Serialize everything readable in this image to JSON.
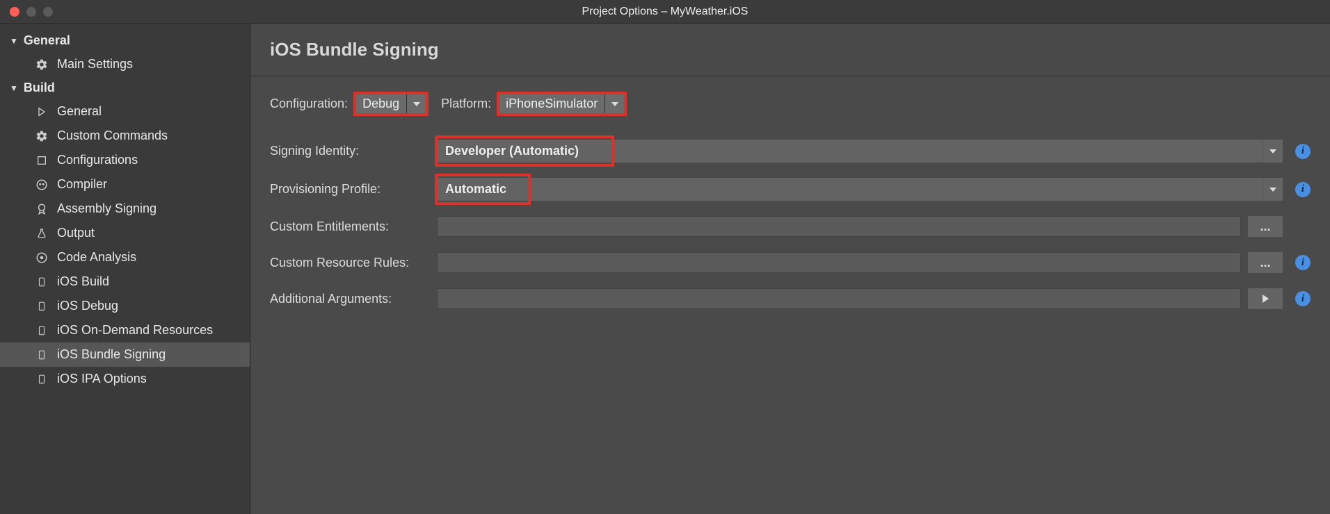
{
  "window": {
    "title": "Project Options – MyWeather.iOS"
  },
  "colors": {
    "close": "#ff5f57",
    "min": "#5b5b5b",
    "max": "#5b5b5b"
  },
  "sidebar": {
    "general": {
      "label": "General",
      "items": [
        {
          "label": "Main Settings"
        }
      ]
    },
    "build": {
      "label": "Build",
      "items": [
        {
          "label": "General"
        },
        {
          "label": "Custom Commands"
        },
        {
          "label": "Configurations"
        },
        {
          "label": "Compiler"
        },
        {
          "label": "Assembly Signing"
        },
        {
          "label": "Output"
        },
        {
          "label": "Code Analysis"
        },
        {
          "label": "iOS Build"
        },
        {
          "label": "iOS Debug"
        },
        {
          "label": "iOS On-Demand Resources"
        },
        {
          "label": "iOS Bundle Signing"
        },
        {
          "label": "iOS IPA Options"
        }
      ]
    }
  },
  "page": {
    "title": "iOS Bundle Signing",
    "configuration": {
      "label": "Configuration:",
      "value": "Debug"
    },
    "platform": {
      "label": "Platform:",
      "value": "iPhoneSimulator"
    },
    "signing_identity": {
      "label": "Signing Identity:",
      "value": "Developer (Automatic)"
    },
    "provisioning_profile": {
      "label": "Provisioning Profile:",
      "value": "Automatic"
    },
    "custom_entitlements": {
      "label": "Custom Entitlements:",
      "value": "",
      "button": "..."
    },
    "custom_resource_rules": {
      "label": "Custom Resource Rules:",
      "value": "",
      "button": "..."
    },
    "additional_arguments": {
      "label": "Additional Arguments:",
      "value": ""
    }
  }
}
